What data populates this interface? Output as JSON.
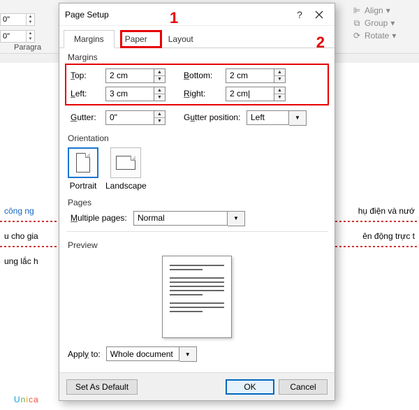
{
  "ribbon": {
    "indent_left": "0\"",
    "indent_right": "0\"",
    "group_paragraph": "Paragra",
    "arrange": {
      "align": "Align",
      "group": "Group",
      "rotate": "Rotate"
    }
  },
  "document": {
    "line1_left": "công ng",
    "line1_right": "hụ điện và nướ",
    "line2_left": "u cho gia",
    "line2_right": "ên động trực t",
    "line3_left": "ung lắc h"
  },
  "dialog": {
    "title": "Page Setup",
    "help": "?",
    "tabs": {
      "margins": "Margins",
      "paper": "Paper",
      "layout": "Layout"
    },
    "annot1": "1",
    "annot2": "2",
    "section_margins": "Margins",
    "margins": {
      "top_label": "Top:",
      "top_value": "2 cm",
      "bottom_label": "Bottom:",
      "bottom_value": "2 cm",
      "left_label": "Left:",
      "left_value": "3 cm",
      "right_label": "Right:",
      "right_value": "2 cm|"
    },
    "gutter": {
      "label": "Gutter:",
      "value": "0\"",
      "pos_label": "Gutter position:",
      "pos_value": "Left"
    },
    "section_orientation": "Orientation",
    "orientation": {
      "portrait": "Portrait",
      "landscape": "Landscape"
    },
    "section_pages": "Pages",
    "pages": {
      "multiple_label": "Multiple pages:",
      "multiple_value": "Normal"
    },
    "section_preview": "Preview",
    "apply": {
      "label": "Apply to:",
      "value": "Whole document"
    },
    "footer": {
      "default": "Set As Default",
      "ok": "OK",
      "cancel": "Cancel"
    }
  },
  "watermark": {
    "u": "U",
    "n": "n",
    "i": "i",
    "c": "c",
    "a": "a"
  }
}
